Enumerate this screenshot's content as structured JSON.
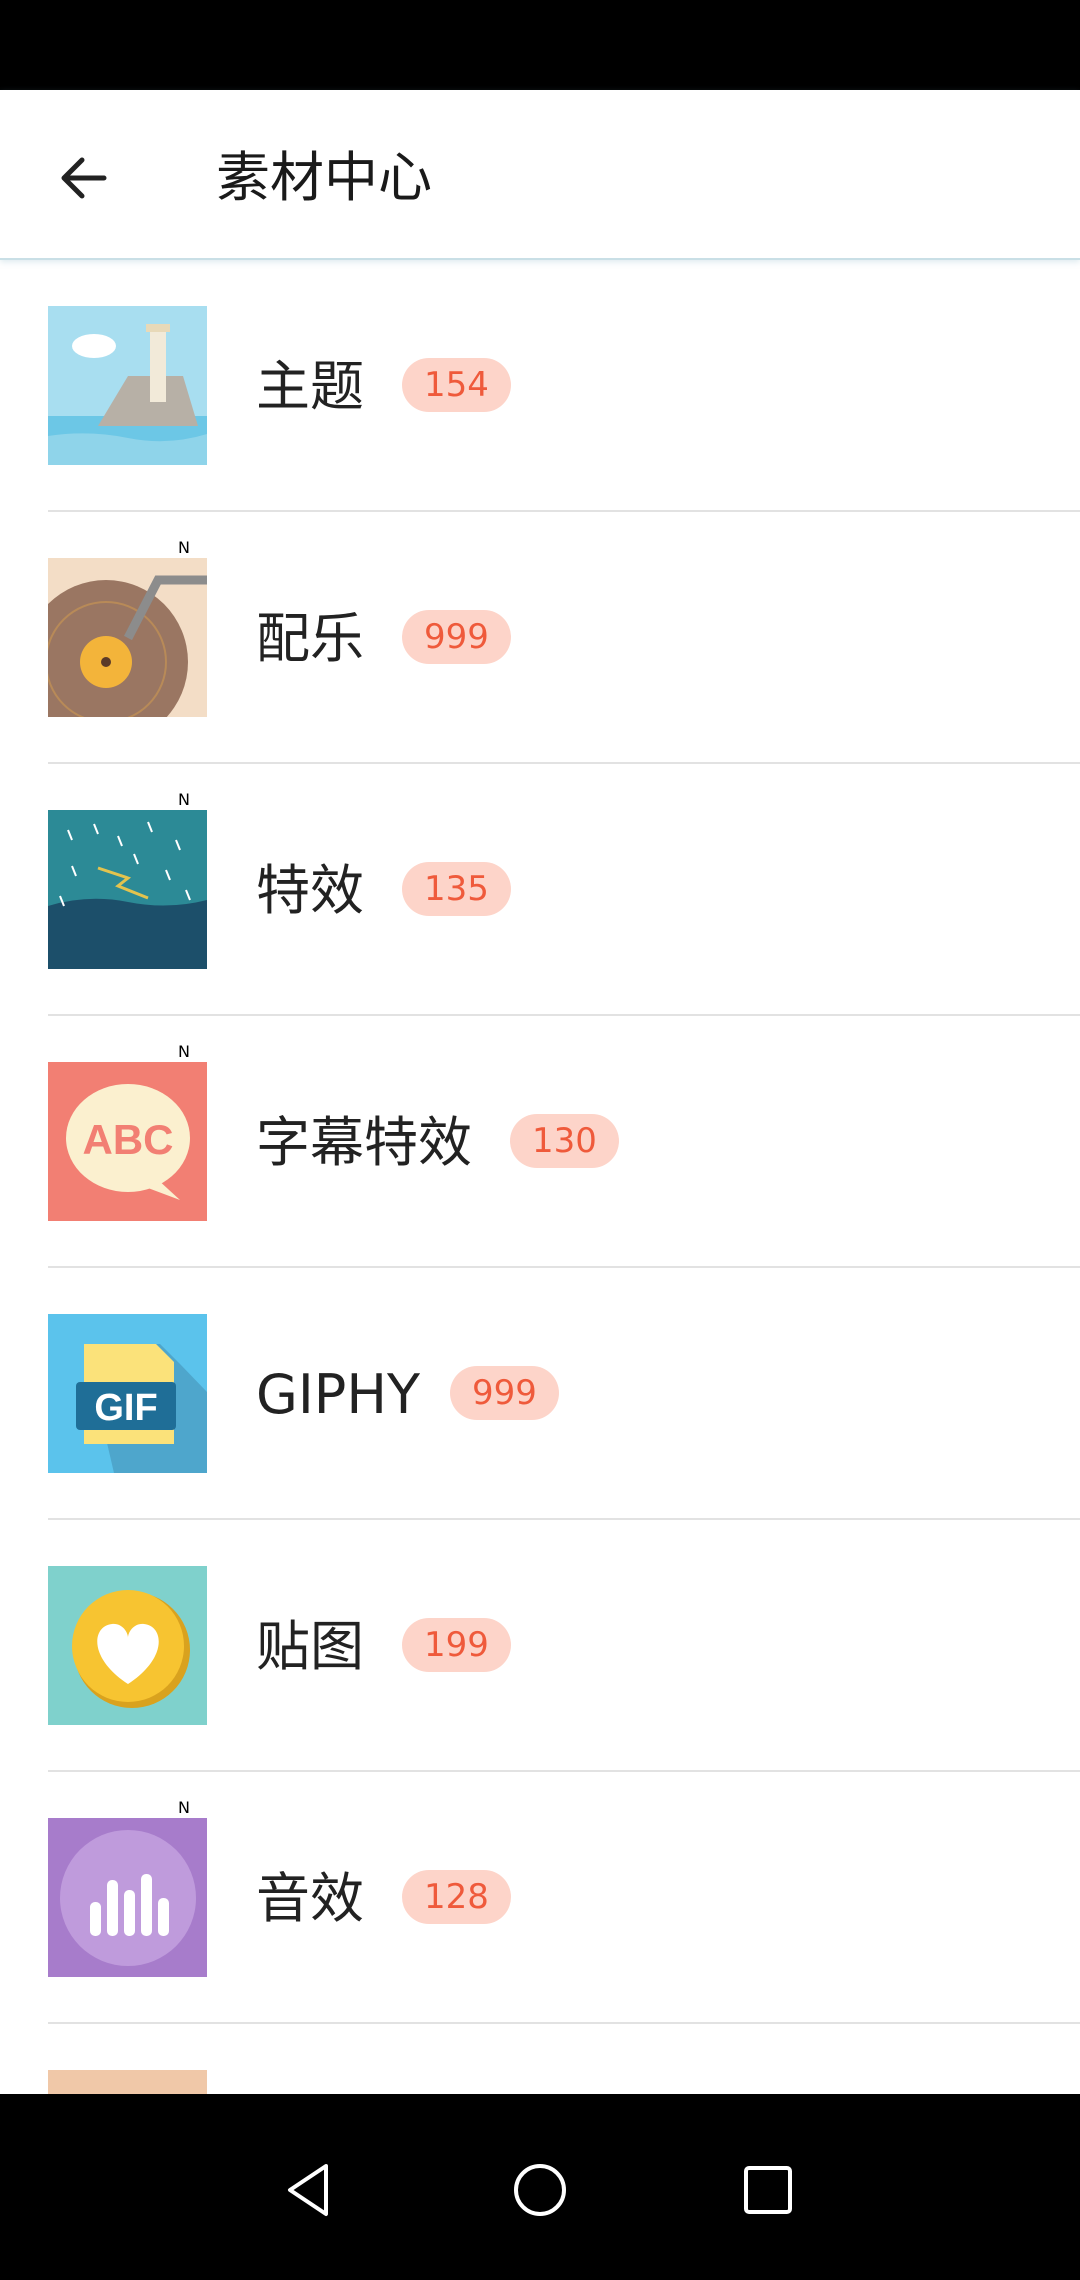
{
  "app_bar": {
    "title": "素材中心",
    "back_icon": "arrow-left-icon"
  },
  "items": [
    {
      "label": "主题",
      "count": "154",
      "is_new": false,
      "icon": "lighthouse-icon"
    },
    {
      "label": "配乐",
      "count": "999",
      "is_new": true,
      "icon": "vinyl-record-icon"
    },
    {
      "label": "特效",
      "count": "135",
      "is_new": true,
      "icon": "rain-lightning-icon"
    },
    {
      "label": "字幕特效",
      "count": "130",
      "is_new": true,
      "icon": "abc-speech-bubble-icon"
    },
    {
      "label": "GIPHY",
      "count": "999",
      "is_new": false,
      "icon": "gif-file-icon"
    },
    {
      "label": "贴图",
      "count": "199",
      "is_new": false,
      "icon": "heart-badge-icon"
    },
    {
      "label": "音效",
      "count": "128",
      "is_new": true,
      "icon": "sound-bars-icon"
    }
  ],
  "new_badge_text": "N",
  "colors": {
    "badge_bg": "#fdd4c9",
    "badge_text": "#ef5a3b",
    "new_dot": "#ff4a1c"
  }
}
